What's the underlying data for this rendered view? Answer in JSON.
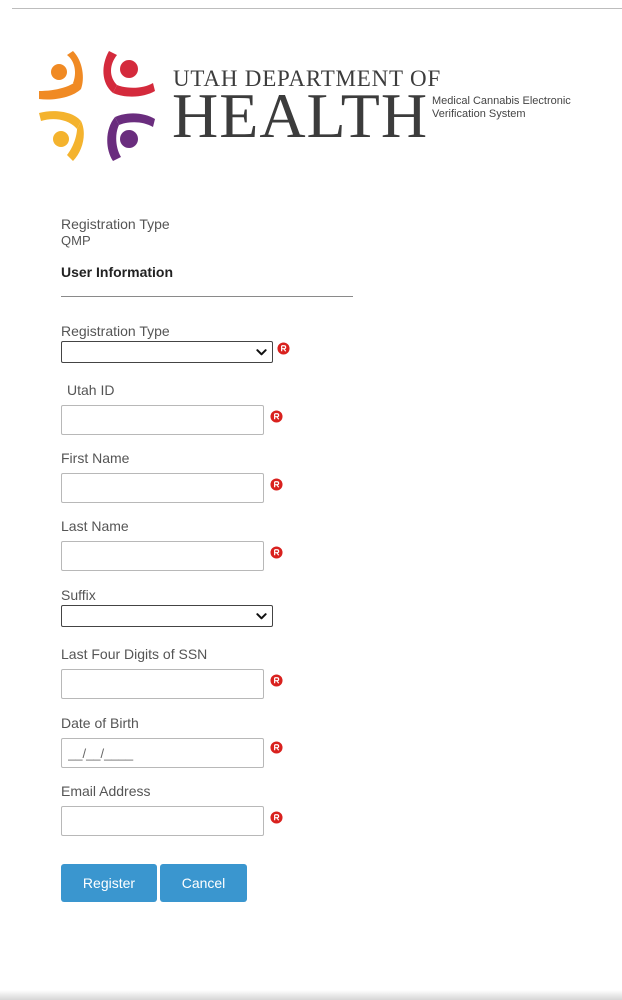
{
  "header": {
    "agency_line1": "UTAH DEPARTMENT OF",
    "agency_line2": "HEALTH",
    "app_name": "Medical Cannabis Electronic Verification System",
    "logo_colors": {
      "orange": "#f08a24",
      "red": "#d42a3c",
      "yellow": "#f4b32e",
      "purple": "#6a2d7e"
    }
  },
  "info": {
    "registration_type_label": "Registration Type",
    "registration_type_value": "QMP",
    "section_heading": "User Information"
  },
  "form": {
    "registration_type": {
      "label": "Registration Type",
      "value": "",
      "required": true
    },
    "utah_id": {
      "label": "Utah ID",
      "value": "",
      "required": true
    },
    "first_name": {
      "label": "First Name",
      "value": "",
      "required": true
    },
    "last_name": {
      "label": "Last Name",
      "value": "",
      "required": true
    },
    "suffix": {
      "label": "Suffix",
      "value": "",
      "required": false
    },
    "ssn_last4": {
      "label": "Last Four Digits of SSN",
      "value": "",
      "required": true
    },
    "dob": {
      "label": "Date of Birth",
      "placeholder": "__/__/____",
      "value": "",
      "required": true
    },
    "email": {
      "label": "Email Address",
      "value": "",
      "required": true
    }
  },
  "buttons": {
    "register_label": "Register",
    "cancel_label": "Cancel",
    "color": "#3a96cf"
  },
  "icons": {
    "required": "required-r-badge-icon",
    "dropdown": "chevron-down-icon"
  },
  "colors": {
    "required_badge": "#d9211e"
  }
}
